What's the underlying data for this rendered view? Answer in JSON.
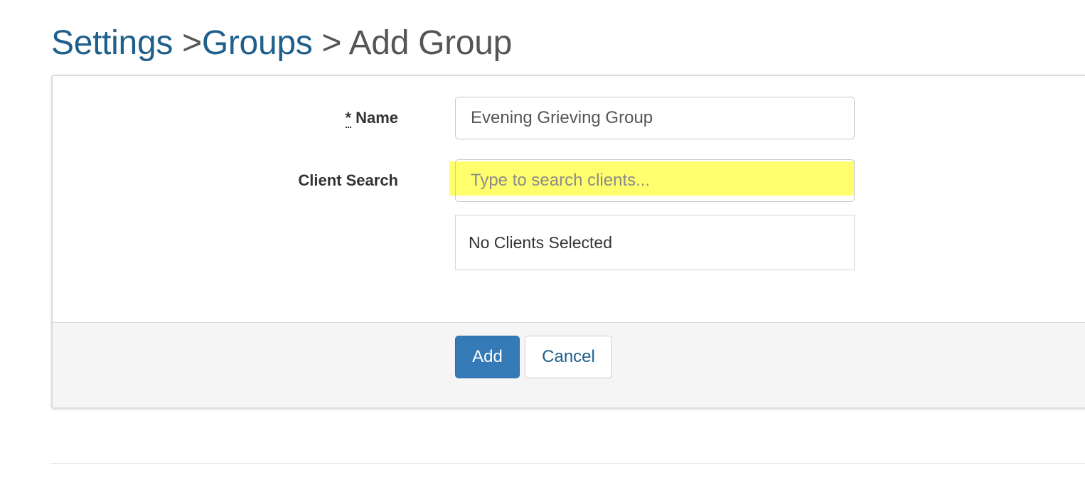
{
  "breadcrumb": {
    "settings": "Settings",
    "sep1": " >",
    "groups": "Groups",
    "sep2": " > ",
    "current": "Add Group"
  },
  "form": {
    "name_required_marker": "*",
    "name_label": "Name",
    "name_value": "Evening Grieving Group",
    "client_search_label": "Client Search",
    "client_search_placeholder": "Type to search clients...",
    "client_search_value": "",
    "selected_clients_text": "No Clients Selected"
  },
  "actions": {
    "add_label": "Add",
    "cancel_label": "Cancel"
  },
  "colors": {
    "link": "#1f5f8b",
    "primary_button": "#337ab7",
    "highlight": "#ffff6e",
    "footer_background": "#f5f5f5"
  }
}
